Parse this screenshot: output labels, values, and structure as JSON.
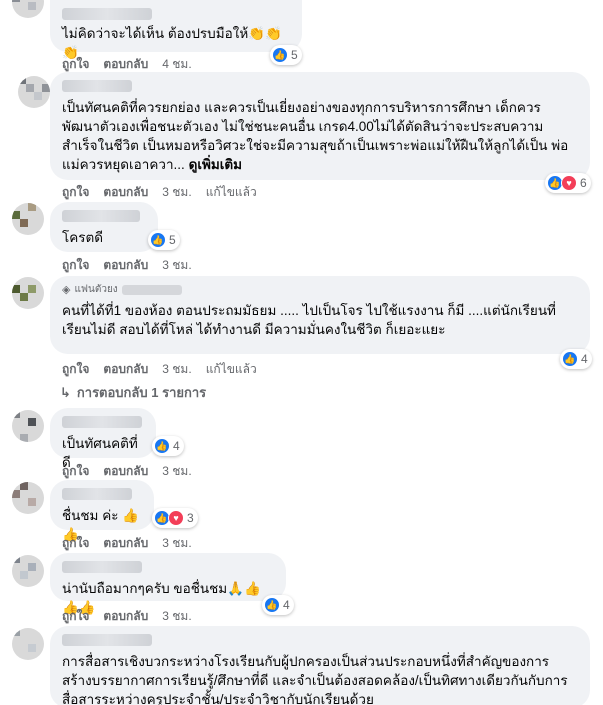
{
  "actions": {
    "like": "ถูกใจ",
    "reply": "ตอบกลับ",
    "edited": "แก้ไขแล้ว"
  },
  "comments": [
    {
      "text": "ไม่คิดว่าจะได้เห็น ต้องปรบมือให้👏👏👏",
      "reaction_count": "5",
      "time": "4 ชม."
    },
    {
      "text": "เป็นทัศนคติที่ควรยกย่อง และควรเป็นเยี่ยงอย่างของทุกการบริหารการศึกษา เด็กควรพัฒนาตัวเองเพื่อชนะตัวเอง ไม่ใช่ชนะคนอื่น เกรด4.00ไม่ได้ตัดสินว่าจะประสบความสำเร็จในชีวิต เป็นหมอหรือวิศวะใช่จะมีความสุขถ้าเป็นเพราะพ่อแม่ให้ฝืนให้ลูกได้เป็น พ่อแม่ควรหยุดเอาควา...",
      "see_more": "ดูเพิ่มเติม",
      "reaction_count": "6",
      "time": "3 ชม."
    },
    {
      "text": "โครตดี",
      "reaction_count": "5",
      "time": "3 ชม."
    },
    {
      "badge": "แฟนตัวยง",
      "text": "คนที่ได้ที่1 ของห้อง ตอนประถมมัธยม ..... ไปเป็นโจร ไปใช้แรงงาน ก็มี ....แต่นักเรียนที่เรียนไม่ดี สอบได้ที่โหล่ ได้ทำงานดี มีความมั่นคงในชีวิต ก็เยอะแยะ",
      "reaction_count": "4",
      "time": "3 ชม.",
      "replies": "การตอบกลับ 1 รายการ"
    },
    {
      "text": "เป็นทัศนคติที่ดี",
      "reaction_count": "4",
      "time": "3 ชม."
    },
    {
      "text": "ชื่นชม ค่ะ 👍👍",
      "reaction_count": "3",
      "time": "3 ชม."
    },
    {
      "text": "น่านับถือมากๆครับ ขอชื่นชม🙏👍👍👍",
      "reaction_count": "4",
      "time": "3 ชม."
    },
    {
      "text": "การสื่อสารเชิงบวกระหว่างโรงเรียนกับผู้ปกครองเป็นส่วนประกอบหนึ่งที่สำคัญของการสร้างบรรยากาศการเรียนรู้/ศึกษาที่ดี และจำเป็นต้องสอดคล้อง/เป็นทิศทางเดียวกันกับการสื่อสารระหว่างครูประจำชั้น/ประจำวิชากับนักเรียนด้วย"
    }
  ]
}
